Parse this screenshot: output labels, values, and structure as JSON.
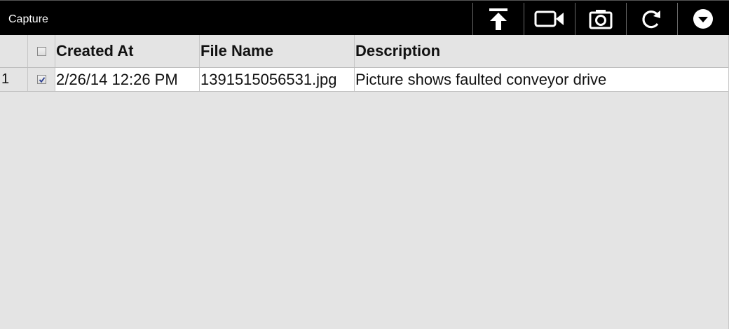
{
  "window": {
    "title": "Capture"
  },
  "toolbar": {
    "buttons": [
      {
        "icon": "upload-icon"
      },
      {
        "icon": "video-camera-icon"
      },
      {
        "icon": "camera-icon"
      },
      {
        "icon": "refresh-icon"
      },
      {
        "icon": "chevron-down-circle-icon"
      }
    ]
  },
  "table": {
    "header": {
      "index": "",
      "select_all_checked": false,
      "columns": [
        "Created At",
        "File Name",
        "Description"
      ]
    },
    "rows": [
      {
        "index": "1",
        "checked": true,
        "created_at": "2/26/14 12:26 PM",
        "file_name": "1391515056531.jpg",
        "description": "Picture shows faulted conveyor drive"
      }
    ]
  },
  "colors": {
    "titlebar": "#000000",
    "background": "#e4e4e4",
    "row": "#ffffff"
  }
}
